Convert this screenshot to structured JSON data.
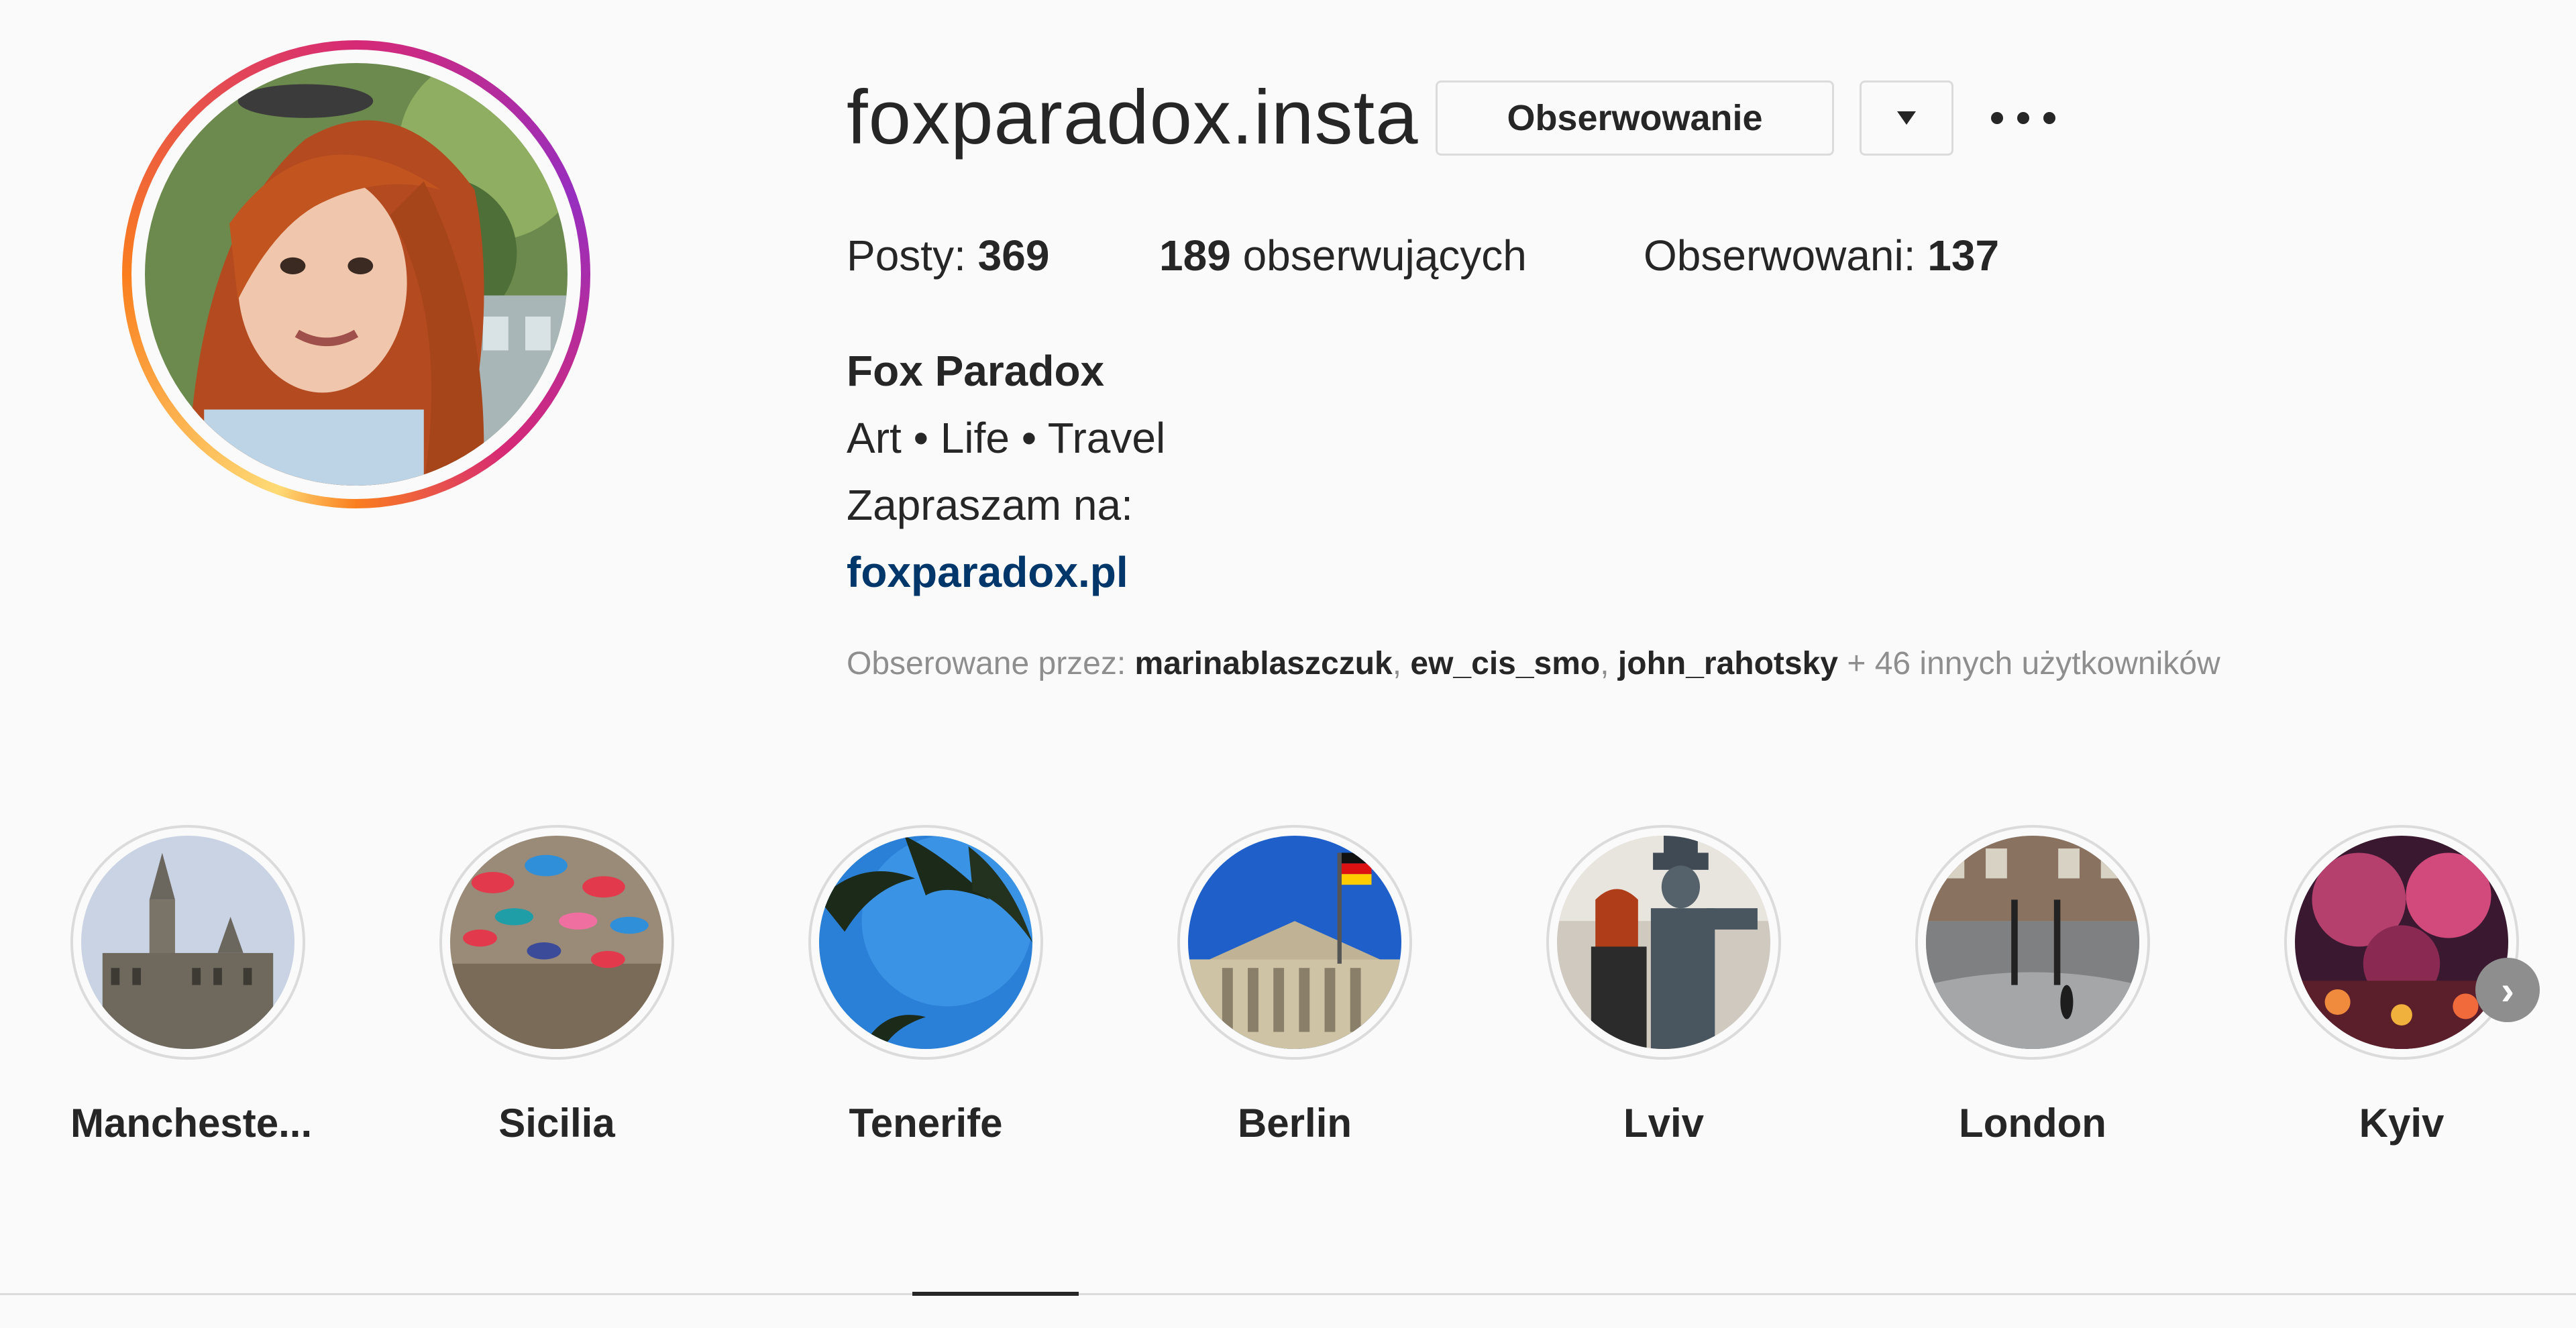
{
  "profile": {
    "username": "foxparadox.insta",
    "follow_button": "Obserwowanie",
    "dropdown_icon": "caret-down-icon",
    "more_icon": "more-options-icon"
  },
  "stats": {
    "posts_label": "Posty:",
    "posts_count": "369",
    "followers_count": "189",
    "followers_label": "obserwujących",
    "following_label": "Obserwowani:",
    "following_count": "137"
  },
  "bio": {
    "name": "Fox Paradox",
    "line1": "Art • Life • Travel",
    "line2": "Zapraszam na:",
    "link": "foxparadox.pl"
  },
  "followed_by": {
    "prefix": "Obserowane przez:",
    "users": [
      "marinablaszczuk",
      "ew_cis_smo",
      "john_rahotsky"
    ],
    "suffix": "+ 46 innych użytkowników"
  },
  "highlights": [
    {
      "label": "Mancheste..."
    },
    {
      "label": "Sicilia"
    },
    {
      "label": "Tenerife"
    },
    {
      "label": "Berlin"
    },
    {
      "label": "Lviv"
    },
    {
      "label": "London"
    },
    {
      "label": "Kyiv"
    }
  ],
  "colors": {
    "link": "#00376b",
    "muted": "#8e8e8e",
    "border": "#dbdbdb",
    "text": "#262626"
  }
}
